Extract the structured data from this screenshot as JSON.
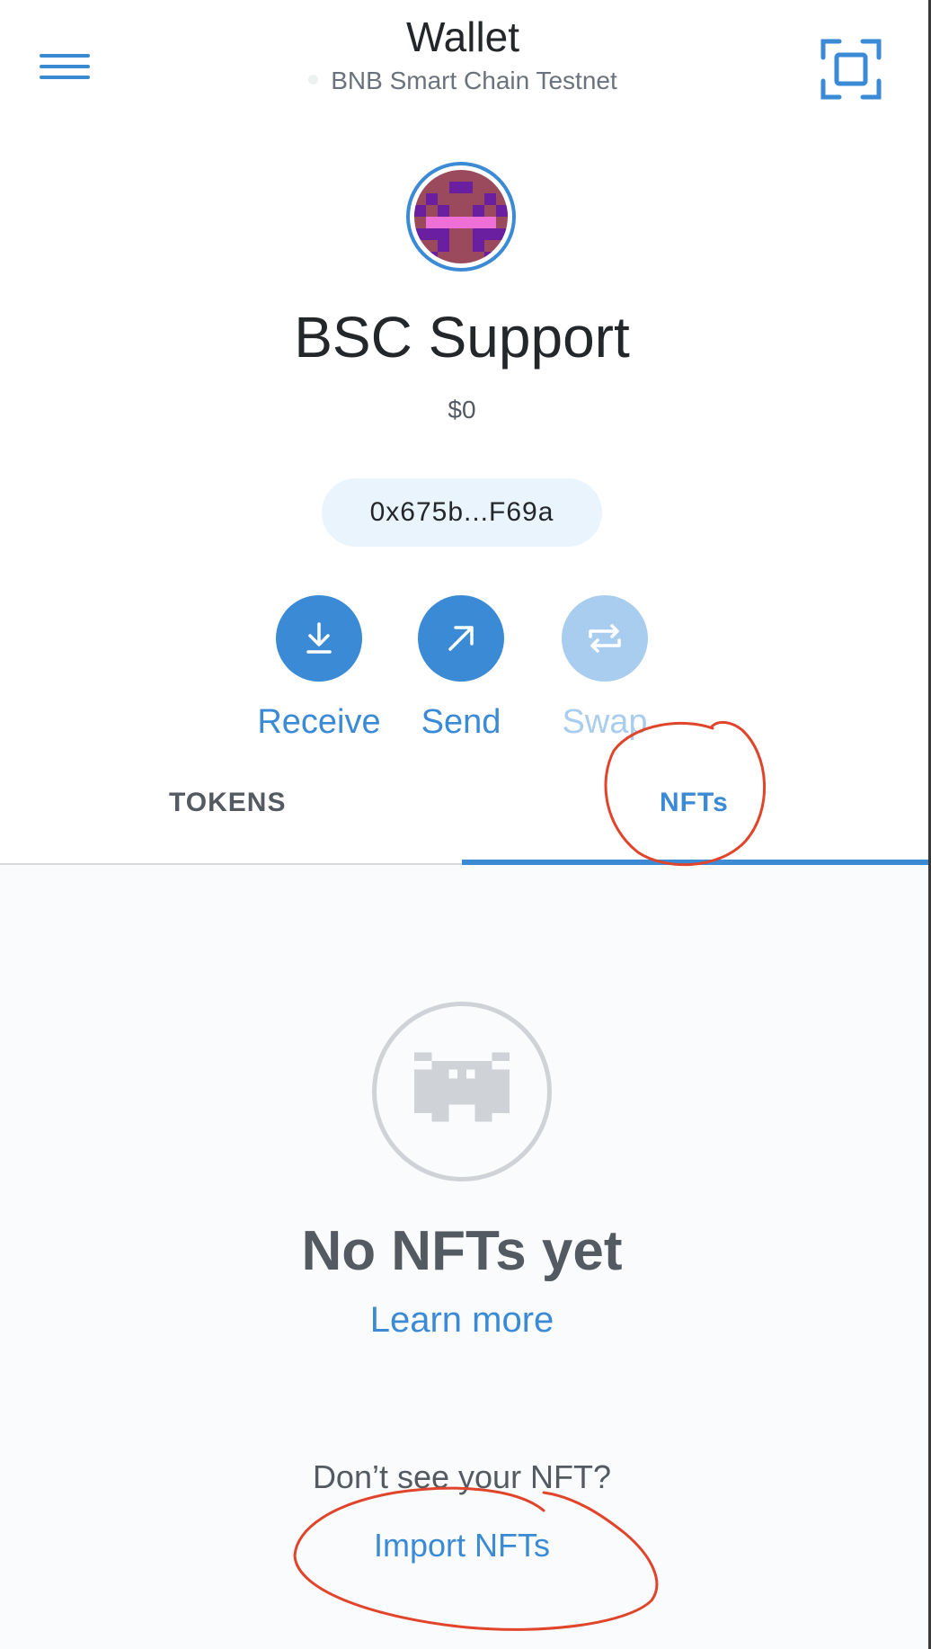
{
  "header": {
    "title": "Wallet",
    "network_name": "BNB Smart Chain Testnet",
    "menu_icon": "hamburger-menu-icon",
    "scan_icon": "qr-scan-icon"
  },
  "account": {
    "name": "BSC Support",
    "balance": "$0",
    "address": "0x675b...F69a"
  },
  "actions": [
    {
      "label": "Receive",
      "icon": "download-arrow-icon",
      "enabled": true
    },
    {
      "label": "Send",
      "icon": "arrow-up-right-icon",
      "enabled": true
    },
    {
      "label": "Swap",
      "icon": "swap-arrows-icon",
      "enabled": false
    }
  ],
  "tabs": [
    {
      "label": "TOKENS",
      "active": false
    },
    {
      "label": "NFTs",
      "active": true
    }
  ],
  "nft_empty": {
    "icon": "space-invader-icon",
    "title": "No NFTs yet",
    "learn_more": "Learn more",
    "prompt": "Don’t see your NFT?",
    "import_label": "Import NFTs"
  },
  "colors": {
    "accent": "#3a8ad6",
    "accent_disabled": "#a9cdef",
    "annotation": "#e0452b"
  }
}
